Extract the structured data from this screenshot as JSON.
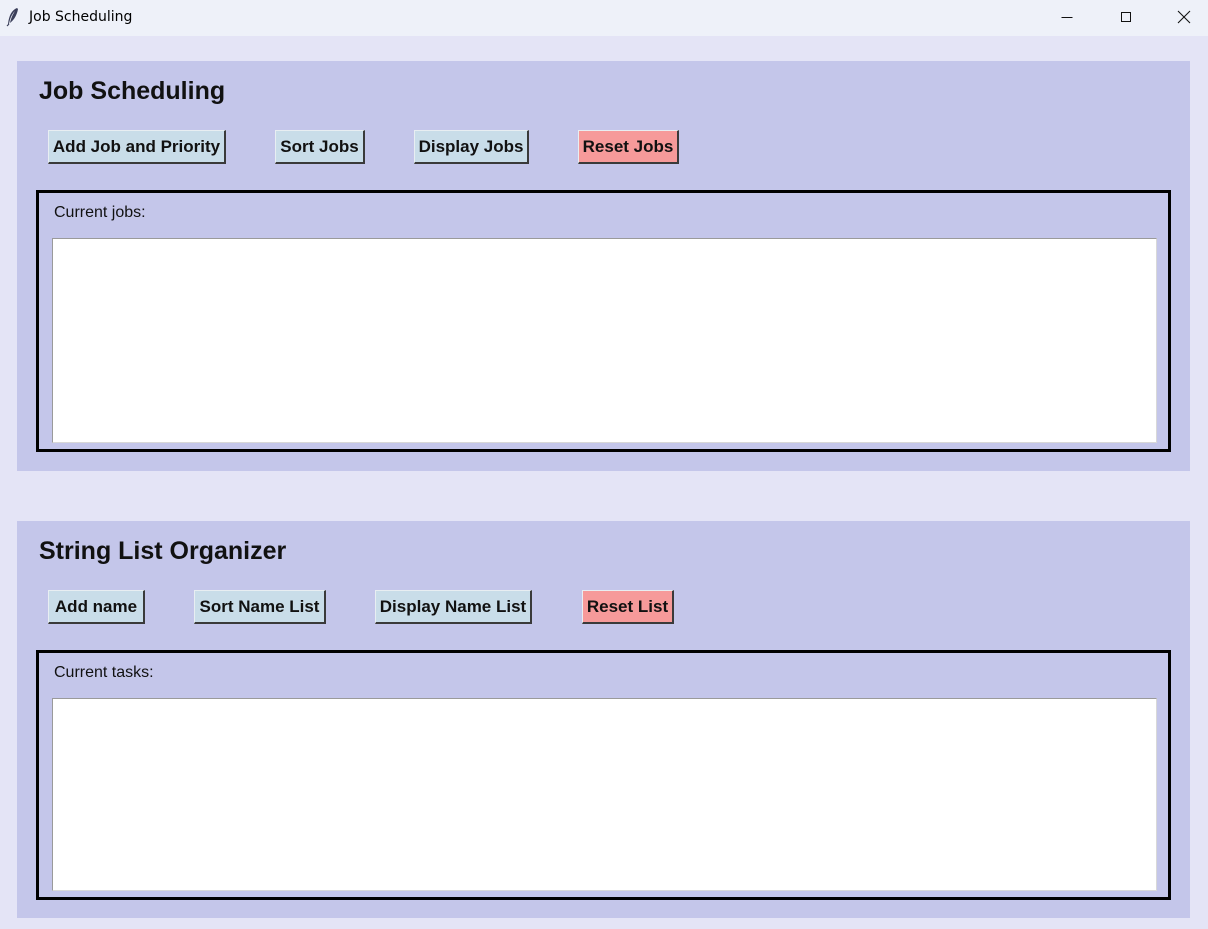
{
  "window": {
    "title": "Job Scheduling",
    "icons": {
      "app": "feather-icon",
      "minimize": "minimize-icon",
      "maximize": "maximize-icon",
      "close": "close-icon"
    }
  },
  "job_section": {
    "title": "Job Scheduling",
    "buttons": {
      "add": "Add Job and Priority",
      "sort": "Sort Jobs",
      "display": "Display Jobs",
      "reset": "Reset Jobs"
    },
    "list_label": "Current jobs:",
    "list_value": ""
  },
  "string_section": {
    "title": "String List Organizer",
    "buttons": {
      "add": "Add name",
      "sort": "Sort Name List",
      "display": "Display Name List",
      "reset": "Reset List"
    },
    "list_label": "Current tasks:",
    "list_value": ""
  },
  "colors": {
    "window_background": "#e4e4f6",
    "panel_background": "#c4c6ea",
    "button": "#c9dde9",
    "reset_button": "#f69a9a",
    "titlebar": "#eef1f9"
  }
}
